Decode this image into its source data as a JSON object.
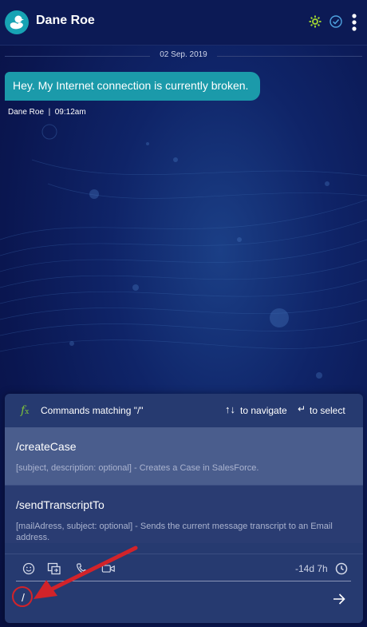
{
  "header": {
    "title": "Dane Roe",
    "avatar_icon": "duck-icon",
    "settings_icon": "gear-icon",
    "status_icon": "check-circle-icon",
    "menu_icon": "more-vertical-icon",
    "colors": {
      "bar": "#0c1a55",
      "gear": "#9acd32",
      "check": "#4fa3e0",
      "avatar": "#17a3b4"
    }
  },
  "conversation": {
    "date": "02 Sep. 2019",
    "messages": [
      {
        "text": "Hey. My Internet connection is currently broken.",
        "meta": "Dane Roe  |  09:12am",
        "color": "#1b9aaa"
      }
    ]
  },
  "commands": {
    "header": "Commands matching \"/\"",
    "navigate_hint": "to navigate",
    "select_hint": "to select",
    "items": [
      {
        "name": "/createCase",
        "description": "[subject, description: optional] - Creates a Case in SalesForce."
      },
      {
        "name": "/sendTranscriptTo",
        "description": "[mailAdress, subject: optional] - Sends the current message transcript to an Email address."
      }
    ]
  },
  "toolbar": {
    "icons": [
      "emoji-icon",
      "screen-share-icon",
      "phone-icon",
      "video-icon"
    ],
    "timer": "-14d 7h"
  },
  "composer": {
    "value": "/"
  },
  "annotation": {
    "color": "#d2232a"
  }
}
